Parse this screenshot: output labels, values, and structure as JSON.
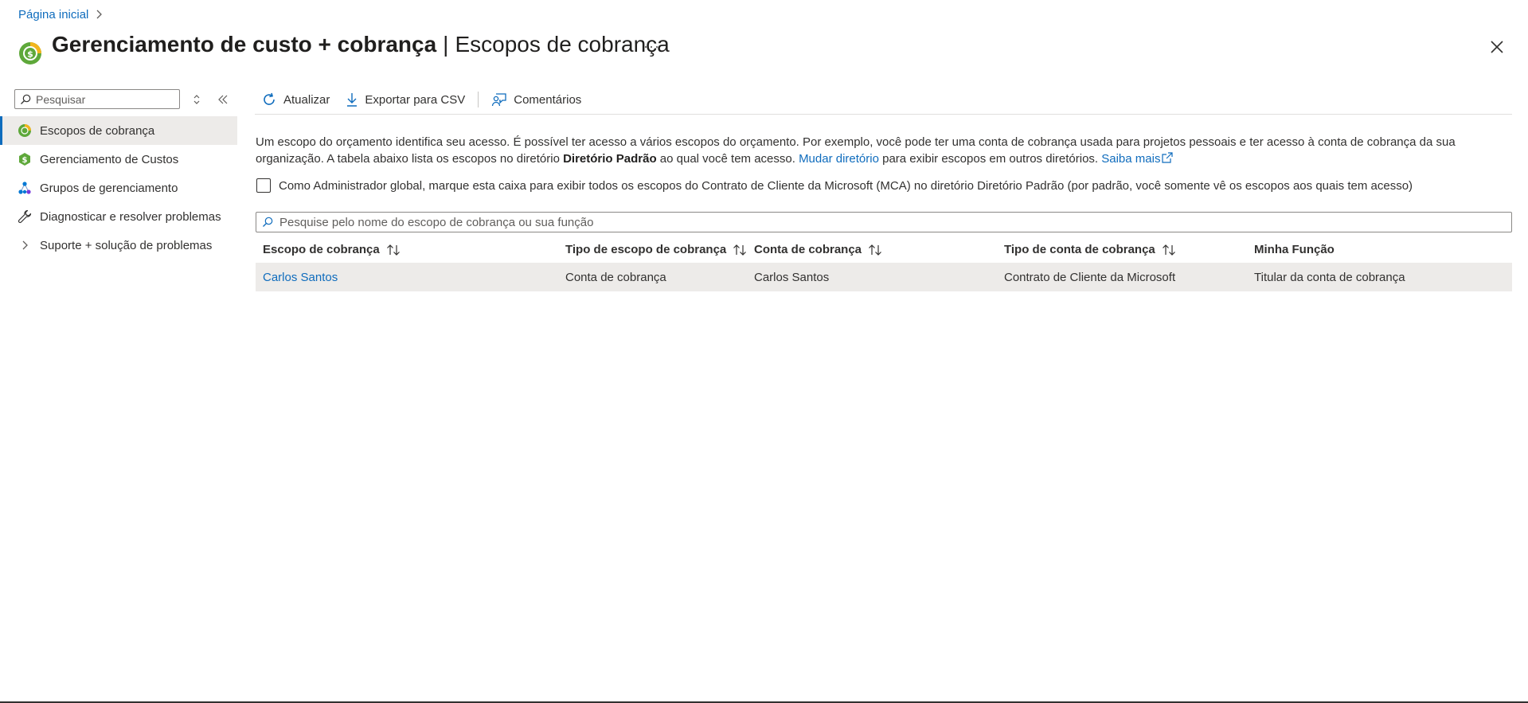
{
  "breadcrumb": {
    "home": "Página inicial"
  },
  "header": {
    "title_main": "Gerenciamento de custo + cobrança",
    "separator": "|",
    "title_sub": "Escopos de cobrança",
    "more": "···"
  },
  "sidebar": {
    "search_placeholder": "Pesquisar",
    "items": [
      {
        "label": "Escopos de cobrança",
        "icon": "billing-scope-icon",
        "active": true
      },
      {
        "label": "Gerenciamento de Custos",
        "icon": "cost-management-icon"
      },
      {
        "label": "Grupos de gerenciamento",
        "icon": "management-groups-icon"
      },
      {
        "label": "Diagnosticar e resolver problemas",
        "icon": "wrench-icon"
      },
      {
        "label": "Suporte + solução de problemas",
        "icon": "chevron-right-icon"
      }
    ]
  },
  "toolbar": {
    "refresh": "Atualizar",
    "export": "Exportar para CSV",
    "feedback": "Comentários"
  },
  "description": {
    "part1": "Um escopo do orçamento identifica seu acesso. É possível ter acesso a vários escopos do orçamento. Por exemplo, você pode ter uma conta de cobrança usada para projetos pessoais e ter acesso à conta de cobrança da sua organização. A tabela abaixo lista os escopos no diretório ",
    "directory": "Diretório Padrão",
    "part2": " ao qual você tem acesso. ",
    "change_dir_link": "Mudar diretório",
    "part3": " para exibir escopos em outros diretórios. ",
    "learn_more_link": "Saiba mais"
  },
  "checkbox_label": "Como Administrador global, marque esta caixa para exibir todos os escopos do Contrato de Cliente da Microsoft (MCA) no diretório Diretório Padrão (por padrão, você somente vê os escopos aos quais tem acesso)",
  "table": {
    "search_placeholder": "Pesquise pelo nome do escopo de cobrança ou sua função",
    "columns": [
      "Escopo de cobrança",
      "Tipo de escopo de cobrança",
      "Conta de cobrança",
      "Tipo de conta de cobrança",
      "Minha Função"
    ],
    "rows": [
      {
        "scope": "Carlos Santos",
        "scope_type": "Conta de cobrança",
        "account": "Carlos Santos",
        "account_type": "Contrato de Cliente da Microsoft",
        "role": "Titular da conta de cobrança"
      }
    ]
  },
  "colors": {
    "accent": "#0f6cbd",
    "selected_bg": "#edebe9",
    "icon_green": "#5ea83a"
  }
}
